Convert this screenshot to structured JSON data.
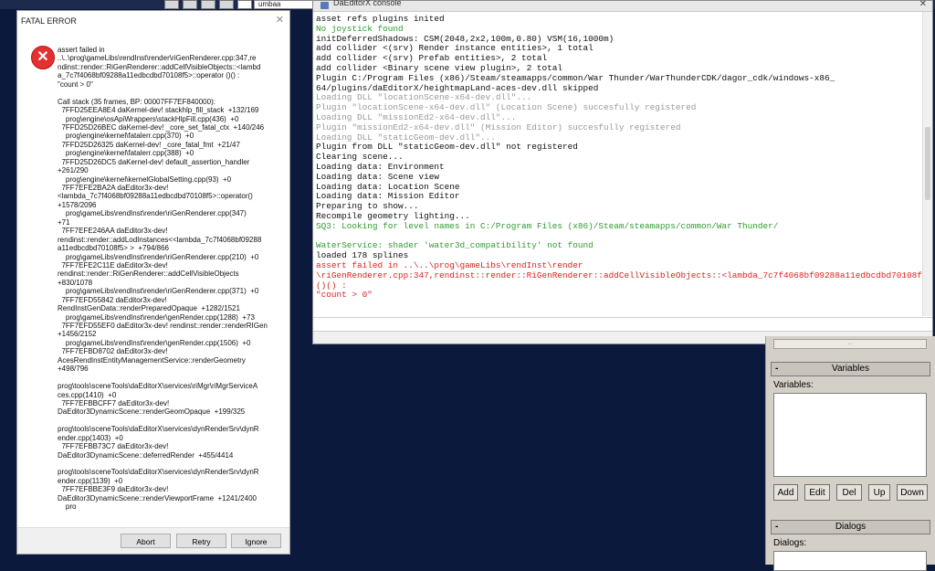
{
  "taskbar": {
    "field_text": "umbaa"
  },
  "console": {
    "title": "DaEditorX console",
    "lines": [
      {
        "t": "asset refs plugins inited",
        "c": "n"
      },
      {
        "t": "No joystick found",
        "c": "g"
      },
      {
        "t": "initDeferredShadows: CSM(2048,2x2,100m,0.80) VSM(16,1000m)",
        "c": "n"
      },
      {
        "t": "add collider <(srv) Render instance entities>, 1 total",
        "c": "n"
      },
      {
        "t": "add collider <(srv) Prefab entities>, 2 total",
        "c": "n"
      },
      {
        "t": "add collider <Binary scene view plugin>, 2 total",
        "c": "n"
      },
      {
        "t": "Plugin C:/Program Files (x86)/Steam/steamapps/common/War Thunder/WarThunderCDK/dagor_cdk/windows-x86_",
        "c": "n"
      },
      {
        "t": "64/plugins/daEditorX/heightmapLand-aces-dev.dll skipped",
        "c": "n"
      },
      {
        "t": "Loading DLL \"locationScene-x64-dev.dll\"...",
        "c": "d"
      },
      {
        "t": "Plugin \"locationScene-x64-dev.dll\" (Location Scene) succesfully registered",
        "c": "d"
      },
      {
        "t": "Loading DLL \"missionEd2-x64-dev.dll\"...",
        "c": "d"
      },
      {
        "t": "Plugin \"missionEd2-x64-dev.dll\" (Mission Editor) succesfully registered",
        "c": "d"
      },
      {
        "t": "Loading DLL \"staticGeom-dev.dll\"...",
        "c": "d"
      },
      {
        "t": "Plugin from DLL \"staticGeom-dev.dll\" not registered",
        "c": "n"
      },
      {
        "t": "Clearing scene...",
        "c": "n"
      },
      {
        "t": "Loading data: Environment",
        "c": "n"
      },
      {
        "t": "Loading data: Scene view",
        "c": "n"
      },
      {
        "t": "Loading data: Location Scene",
        "c": "n"
      },
      {
        "t": "Loading data: Mission Editor",
        "c": "n"
      },
      {
        "t": "Preparing to show...",
        "c": "n"
      },
      {
        "t": "Recompile geometry lighting...",
        "c": "n"
      },
      {
        "t": "SQ3: Looking for level names in C:/Program Files (x86)/Steam/steamapps/common/War Thunder/",
        "c": "g"
      },
      {
        "t": "",
        "c": "n"
      },
      {
        "t": "WaterService: shader 'water3d_compatibility' not found",
        "c": "g"
      },
      {
        "t": "loaded 178 splines",
        "c": "n"
      },
      {
        "t": "assert failed in ..\\..\\prog\\gameLibs\\rendInst\\render",
        "c": "r"
      },
      {
        "t": "\\riGenRenderer.cpp:347,rendinst::render::RiGenRenderer::addCellVisibleObjects::<lambda_7c7f4068bf09288a11edbcdbd70108f5>::operator",
        "c": "r"
      },
      {
        "t": "()() :",
        "c": "r"
      },
      {
        "t": "\"count > 0\"",
        "c": "r"
      }
    ]
  },
  "panel": {
    "top_field": "...",
    "variables_header": "Variables",
    "variables_label": "Variables:",
    "buttons": {
      "add": "Add",
      "edit": "Edit",
      "del": "Del",
      "up": "Up",
      "down": "Down"
    },
    "dialogs_header": "Dialogs",
    "dialogs_label": "Dialogs:",
    "collapse_sign": "-"
  },
  "dialog": {
    "title": "FATAL ERROR",
    "close": "✕",
    "icon": "error-icon",
    "lines": [
      "assert failed in",
      "..\\..\\prog\\gameLibs\\rendInst\\render\\riGenRenderer.cpp:347,re",
      "ndinst::render::RiGenRenderer::addCellVisibleObjects::<lambd",
      "a_7c7f4068bf09288a11edbcdbd70108f5>::operator ()() :",
      "\"count > 0\"",
      "",
      "Call stack (35 frames, BP: 00007FF7EF840000):",
      "  7FFD25EEA8E4 daKernel-dev! stackhlp_fill_stack  +132/169",
      "    prog\\engine\\osApiWrappers\\stackHlpFill.cpp(436)  +0",
      "  7FFD25D26BEC daKernel-dev! _core_set_fatal_ctx  +140/246",
      "    prog\\engine\\kernel\\fatalerr.cpp(370)  +0",
      "  7FFD25D26325 daKernel-dev! _core_fatal_fmt  +21/47",
      "    prog\\engine\\kernel\\fatalerr.cpp(388)  +0",
      "  7FFD25D26DC5 daKernel-dev! default_assertion_handler",
      "+261/290",
      "    prog\\engine\\kernel\\kernelGlobalSetting.cpp(93)  +0",
      "  7FF7EFE2BA2A daEditor3x-dev!",
      "<lambda_7c7f4068bf09288a11edbcdbd70108f5>::operator()",
      "+1578/2096",
      "    prog\\gameLibs\\rendInst\\render\\riGenRenderer.cpp(347)",
      "+71",
      "  7FF7EFE246AA daEditor3x-dev!",
      "rendinst::render::addLodInstances<<lambda_7c7f4068bf09288",
      "a11edbcdbd70108f5> >  +794/866",
      "    prog\\gameLibs\\rendInst\\render\\riGenRenderer.cpp(210)  +0",
      "  7FF7EFE2C11E daEditor3x-dev!",
      "rendinst::render::RiGenRenderer::addCellVisibleObjects",
      "+830/1078",
      "    prog\\gameLibs\\rendInst\\render\\riGenRenderer.cpp(371)  +0",
      "  7FF7EFD55842 daEditor3x-dev!",
      "RendInstGenData::renderPreparedOpaque  +1282/1521",
      "    prog\\gameLibs\\rendInst\\render\\genRender.cpp(1288)  +73",
      "  7FF7EFD55EF0 daEditor3x-dev! rendinst::render::renderRIGen",
      "+1456/2152",
      "    prog\\gameLibs\\rendInst\\render\\genRender.cpp(1506)  +0",
      "  7FF7EFBD8702 daEditor3x-dev!",
      "AcesRendInstEntityManagementService::renderGeometry",
      "+498/796",
      "",
      "prog\\tools\\sceneTools\\daEditorX\\services\\riMgr\\riMgrServiceA",
      "ces.cpp(1410)  +0",
      "  7FF7EFBBCFF7 daEditor3x-dev!",
      "DaEditor3DynamicScene::renderGeomOpaque  +199/325",
      "",
      "prog\\tools\\sceneTools\\daEditorX\\services\\dynRenderSrv\\dynR",
      "ender.cpp(1403)  +0",
      "  7FF7EFBB73C7 daEditor3x-dev!",
      "DaEditor3DynamicScene::deferredRender  +455/4414",
      "",
      "prog\\tools\\sceneTools\\daEditorX\\services\\dynRenderSrv\\dynR",
      "ender.cpp(1139)  +0",
      "  7FF7EFBBE3F9 daEditor3x-dev!",
      "DaEditor3DynamicScene::renderViewportFrame  +1241/2400",
      "    pro"
    ],
    "buttons": {
      "abort": "Abort",
      "retry": "Retry",
      "ignore": "Ignore"
    }
  }
}
